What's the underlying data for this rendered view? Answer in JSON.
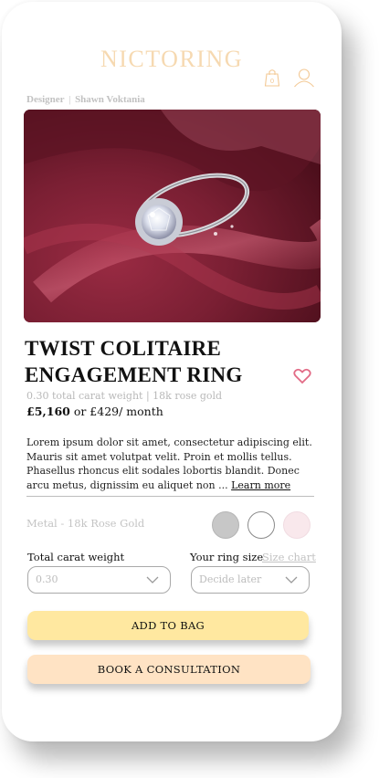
{
  "header": {
    "brand": "NICTORING",
    "bag_count": "0",
    "brand_color": "#f6d9b1"
  },
  "designer": {
    "label": "Designer",
    "separator": "|",
    "name": "Shawn Voktania"
  },
  "product": {
    "title": "TWIST COLITAIRE ENGAGEMENT RING",
    "meta": "0.30 total carat weight | 18k rose gold",
    "price": "£5,160",
    "finance": "or £429/ month",
    "description": "Lorem ipsum dolor sit amet, consectetur adipiscing elit. Mauris sit amet volutpat velit. Proin et mollis tellus. Phasellus rhoncus elit sodales lobortis blandit. Donec arcu metus, dignissim eu aliquet non ...",
    "learn_more": "Learn more"
  },
  "options": {
    "metal_label": "Metal - 18k Rose Gold",
    "swatches": [
      "#c7c7c7",
      "#ffffff",
      "#f9e8ec"
    ],
    "carat_label": "Total carat weight",
    "carat_value": "0.30",
    "size_label": "Your ring size",
    "size_chart": "Size chart",
    "size_value": "Decide later"
  },
  "actions": {
    "add_to_bag": "ADD TO BAG",
    "book_consultation": "BOOK A CONSULTATION",
    "add_color": "#ffe8a0",
    "consult_color": "#ffe3c4"
  }
}
